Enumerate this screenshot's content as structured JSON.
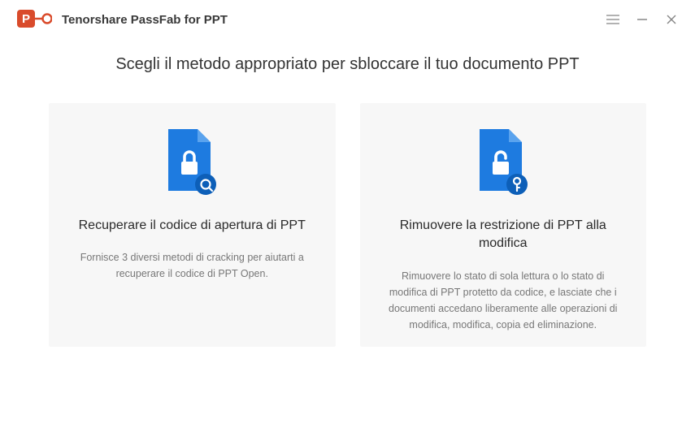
{
  "app": {
    "title": "Tenorshare PassFab for PPT"
  },
  "heading": "Scegli il metodo appropriato per sbloccare il tuo documento PPT",
  "cards": {
    "recover": {
      "title": "Recuperare il codice di apertura di PPT",
      "desc": "Fornisce 3 diversi metodi di cracking per aiutarti a recuperare il codice di PPT Open."
    },
    "remove": {
      "title": "Rimuovere la restrizione di PPT alla modifica",
      "desc": "Rimuovere lo stato di sola lettura o lo stato di modifica di PPT protetto da codice, e lasciate che i documenti accedano liberamente alle operazioni di modifica, modifica, copia ed eliminazione."
    }
  }
}
